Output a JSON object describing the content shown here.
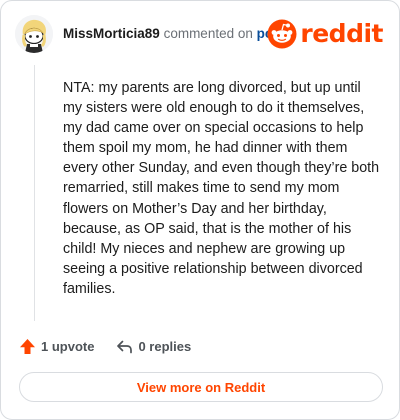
{
  "comment": {
    "username": "MissMorticia89",
    "action_text": "commented on",
    "post_link": "post",
    "body": "NTA: my parents are long divorced, but up until my sisters were old enough to do it themselves, my dad came over on special occasions to help them spoil my mom, he had dinner with them every other Sunday, and even though they’re both remarried, still makes time to send my mom flowers on Mother’s Day and her birthday, because, as OP said, that is the mother of his child! My nieces and nephew are growing up seeing a positive relationship between divorced families."
  },
  "brand": {
    "wordmark": "reddit",
    "color": "#ff4500"
  },
  "actions": {
    "upvote_label": "1 upvote",
    "replies_label": "0 replies"
  },
  "footer": {
    "view_more_label": "View more on Reddit"
  },
  "icons": {
    "avatar": "snoo-avatar",
    "brand": "reddit-snoo-logo",
    "upvote": "upvote-arrow-icon",
    "reply": "reply-arrow-icon"
  }
}
